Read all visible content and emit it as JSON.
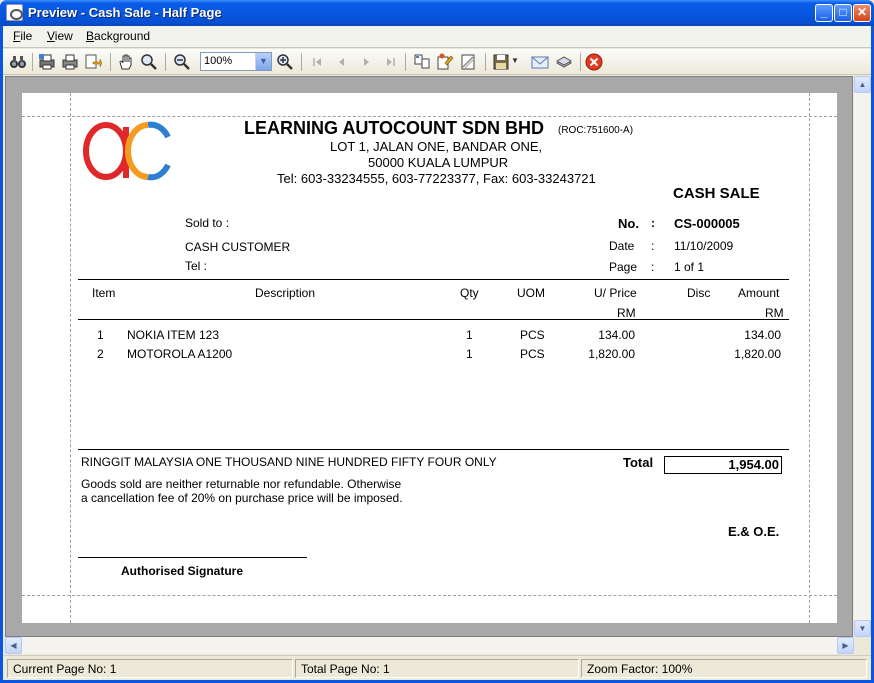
{
  "window": {
    "title": "Preview - Cash Sale - Half Page",
    "min_label": "_",
    "max_label": "□",
    "close_label": "✕"
  },
  "menu": [
    "File",
    "View",
    "Background"
  ],
  "toolbar": {
    "zoom_value": "100%",
    "icons": [
      "binoculars-icon",
      "print-setup-icon",
      "print-icon",
      "export-icon",
      "hand-icon",
      "zoom-tool-icon",
      "zoom-out-icon",
      "zoom-in-icon",
      "first-page-icon",
      "prev-page-icon",
      "next-page-icon",
      "last-page-icon",
      "multi-page-icon",
      "edit-icon",
      "watermark-icon",
      "save-icon",
      "email-icon",
      "background-icon",
      "exit-icon"
    ]
  },
  "document": {
    "company_name": "LEARNING AUTOCOUNT SDN BHD",
    "roc": "(ROC:751600-A)",
    "address1": "LOT 1, JALAN ONE,  BANDAR ONE,",
    "address2": "50000  KUALA LUMPUR",
    "contact": "Tel:  603-33234555,  603-77223377,  Fax: 603-33243721",
    "doc_title": "CASH  SALE",
    "sold_to_label": "Sold to :",
    "customer": "CASH CUSTOMER",
    "tel_label": "Tel :",
    "no_label": "No.",
    "no_colon": ":",
    "no_value": "CS-000005",
    "date_label": "Date",
    "date_colon": ":",
    "date_value": "11/10/2009",
    "page_label": "Page",
    "page_colon": ":",
    "page_value": "1 of 1",
    "headers": {
      "item": "Item",
      "description": "Description",
      "qty": "Qty",
      "uom": "UOM",
      "uprice": "U/ Price",
      "uprice_unit": "RM",
      "disc": "Disc",
      "amount": "Amount",
      "amount_unit": "RM"
    },
    "rows": [
      {
        "item": "1",
        "description": "NOKIA ITEM 123",
        "qty": "1",
        "uom": "PCS",
        "uprice": "134.00",
        "amount": "134.00"
      },
      {
        "item": "2",
        "description": "MOTOROLA A1200",
        "qty": "1",
        "uom": "PCS",
        "uprice": "1,820.00",
        "amount": "1,820.00"
      }
    ],
    "amount_words": "RINGGIT MALAYSIA ONE THOUSAND NINE HUNDRED FIFTY FOUR ONLY",
    "total_label": "Total",
    "total_value": "1,954.00",
    "note1": "Goods sold are neither returnable nor refundable. Otherwise",
    "note2": "a cancellation fee of 20% on purchase price will be imposed.",
    "eoe": "E.& O.E.",
    "signature_label": "Authorised Signature"
  },
  "status": {
    "current_page": "Current Page No: 1",
    "total_page": "Total Page No: 1",
    "zoom_factor": "Zoom Factor: 100%"
  },
  "colors": {
    "logo_red": "#e0282a",
    "logo_orange": "#f39c1f",
    "logo_blue": "#2e7fd1"
  }
}
